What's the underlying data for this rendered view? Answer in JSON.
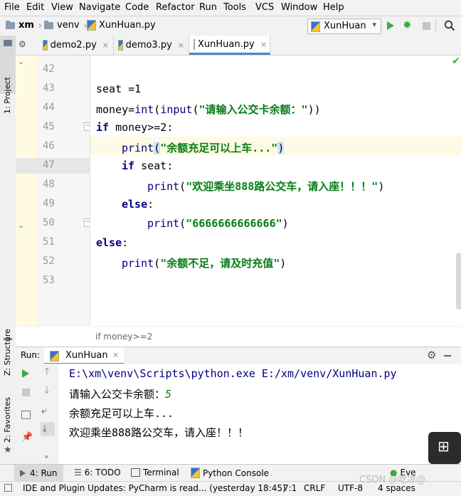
{
  "menu": [
    "File",
    "Edit",
    "View",
    "Navigate",
    "Code",
    "Refactor",
    "Run",
    "Tools",
    "VCS",
    "Window",
    "Help"
  ],
  "breadcrumb": {
    "project": "xm",
    "folder": "venv",
    "file": "XunHuan.py"
  },
  "run_config": "XunHuan",
  "side_left": {
    "project": "1: Project",
    "structure": "Z: Structure",
    "favorites": "2: Favorites"
  },
  "tabs": [
    {
      "label": "demo2.py",
      "close": "×"
    },
    {
      "label": "demo3.py",
      "close": "×"
    },
    {
      "label": "XunHuan.py",
      "close": "×"
    }
  ],
  "line_numbers": [
    "42",
    "43",
    "44",
    "45",
    "46",
    "47",
    "48",
    "49",
    "50",
    "51",
    "52",
    "53"
  ],
  "code": {
    "l43": "seat =1",
    "l44_a": "money=",
    "l44_b": "int",
    "l44_c": "(",
    "l44_d": "input",
    "l44_e": "(",
    "l44_f": "\"请输入公交卡余额：\"",
    "l44_g": "))",
    "l45_kw": "if",
    "l45_rest": " money>=2:",
    "l46_fn": "print",
    "l46_p1": "(",
    "l46_str": "\"余额充足可以上车...\"",
    "l46_p2": ")",
    "l47_kw": "if",
    "l47_rest": " seat:",
    "l48_fn": "print",
    "l48_p1": "(",
    "l48_str": "\"欢迎乘坐888路公交车，请入座！！！\"",
    "l48_p2": ")",
    "l49_kw": "else",
    "l49_rest": ":",
    "l50_fn": "print",
    "l50_p1": "(",
    "l50_str": "\"6666666666666\"",
    "l50_p2": ")",
    "l51_kw": "else",
    "l51_rest": ":",
    "l52_fn": "print",
    "l52_p1": "(",
    "l52_str": "\"余额不足，请及时充值\"",
    "l52_p2": ")"
  },
  "code_breadcrumb": "if money>=2",
  "run_panel": {
    "label": "Run:",
    "tab": "XunHuan"
  },
  "console": {
    "l1": "E:\\xm\\venv\\Scripts\\python.exe E:/xm/venv/XunHuan.py",
    "l2_prompt": "请输入公交卡余额：",
    "l2_input": "5",
    "l3": "余额充足可以上车...",
    "l4": "欢迎乘坐888路公交车，请入座！！！"
  },
  "bottom_tools": {
    "run": "4: Run",
    "todo": "6: TODO",
    "terminal": "Terminal",
    "python_console": "Python Console",
    "event": "Eve"
  },
  "status": {
    "message": "IDE and Plugin Updates: PyCharm is read... (yesterday 18:45)",
    "pos": "7:1",
    "crlf": "CRLF",
    "enc": "UTF-8",
    "indent": "4 spaces"
  },
  "watermark": "CSDN @吃凉@"
}
